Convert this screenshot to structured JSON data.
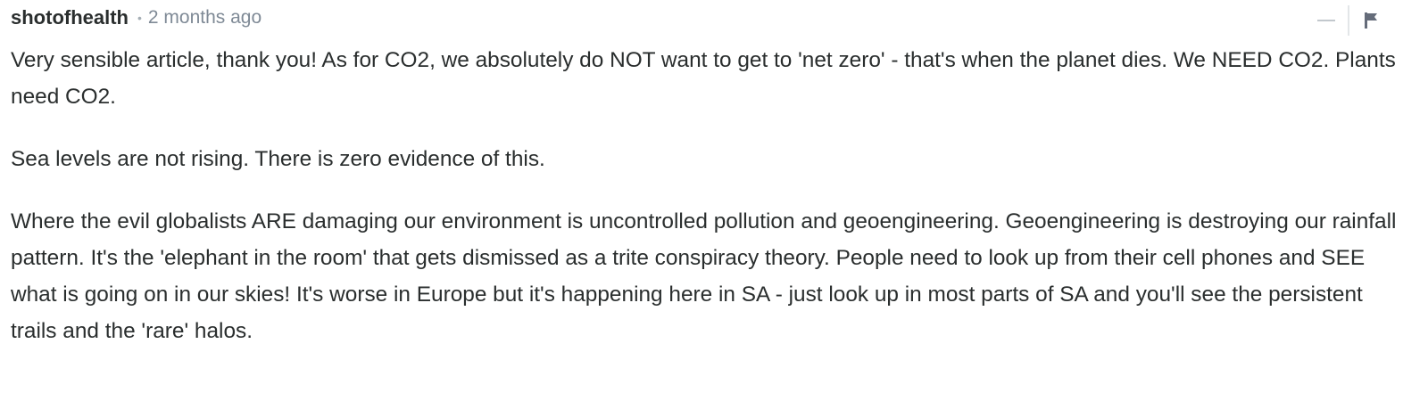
{
  "comment": {
    "author": "shotofhealth",
    "separator": "•",
    "timestamp": "2 months ago",
    "paragraphs": [
      "Very sensible article, thank you! As for CO2, we absolutely do NOT want to get to 'net zero' - that's when the planet dies. We NEED CO2. Plants need CO2.",
      "Sea levels are not rising. There is zero evidence of this.",
      "Where the evil globalists ARE damaging our environment is uncontrolled pollution and geoengineering. Geoengineering is destroying our rainfall pattern. It's the 'elephant in the room' that gets dismissed as a trite conspiracy theory. People need to look up from their cell phones and SEE what is going on in our skies! It's worse in Europe but it's happening here in SA - just look up in most parts of SA and you'll see the persistent trails and the 'rare' halos."
    ]
  },
  "controls": {
    "collapse_icon": "minus-icon",
    "flag_icon": "flag-icon"
  },
  "colors": {
    "text": "#2a2e2e",
    "meta": "#7f8a96",
    "icon": "#c2c8cd"
  }
}
